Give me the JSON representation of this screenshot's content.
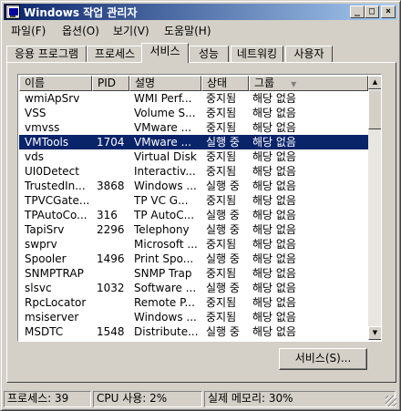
{
  "window": {
    "title": "Windows 작업 관리자",
    "caption_buttons": {
      "minimize": "_",
      "maximize": "□",
      "close": "×"
    }
  },
  "menu": [
    {
      "label": "파일(F)"
    },
    {
      "label": "옵션(O)"
    },
    {
      "label": "보기(V)"
    },
    {
      "label": "도움말(H)"
    }
  ],
  "tabs": [
    {
      "label": "응용 프로그램"
    },
    {
      "label": "프로세스"
    },
    {
      "label": "서비스",
      "active": true
    },
    {
      "label": "성능"
    },
    {
      "label": "네트워킹"
    },
    {
      "label": "사용자"
    }
  ],
  "services": {
    "columns": [
      "이름",
      "PID",
      "설명",
      "상태",
      "그룹"
    ],
    "rows": [
      {
        "name": "wmiApSrv",
        "pid": "",
        "description": "WMI Perf...",
        "status": "중지됨",
        "group": "해당 없음"
      },
      {
        "name": "VSS",
        "pid": "",
        "description": "Volume S...",
        "status": "중지됨",
        "group": "해당 없음"
      },
      {
        "name": "vmvss",
        "pid": "",
        "description": "VMware ...",
        "status": "중지됨",
        "group": "해당 없음"
      },
      {
        "name": "VMTools",
        "pid": "1704",
        "description": "VMware ...",
        "status": "실행 중",
        "group": "해당 없음",
        "selected": true
      },
      {
        "name": "vds",
        "pid": "",
        "description": "Virtual Disk",
        "status": "중지됨",
        "group": "해당 없음"
      },
      {
        "name": "UI0Detect",
        "pid": "",
        "description": "Interactiv...",
        "status": "중지됨",
        "group": "해당 없음"
      },
      {
        "name": "TrustedIn...",
        "pid": "3868",
        "description": "Windows ...",
        "status": "실행 중",
        "group": "해당 없음"
      },
      {
        "name": "TPVCGate...",
        "pid": "",
        "description": "TP VC G...",
        "status": "중지됨",
        "group": "해당 없음"
      },
      {
        "name": "TPAutoCo...",
        "pid": "316",
        "description": "TP AutoC...",
        "status": "실행 중",
        "group": "해당 없음"
      },
      {
        "name": "TapiSrv",
        "pid": "2296",
        "description": "Telephony",
        "status": "실행 중",
        "group": "해당 없음"
      },
      {
        "name": "swprv",
        "pid": "",
        "description": "Microsoft ...",
        "status": "중지됨",
        "group": "해당 없음"
      },
      {
        "name": "Spooler",
        "pid": "1496",
        "description": "Print Spo...",
        "status": "실행 중",
        "group": "해당 없음"
      },
      {
        "name": "SNMPTRAP",
        "pid": "",
        "description": "SNMP Trap",
        "status": "중지됨",
        "group": "해당 없음"
      },
      {
        "name": "slsvc",
        "pid": "1032",
        "description": "Software ...",
        "status": "실행 중",
        "group": "해당 없음"
      },
      {
        "name": "RpcLocator",
        "pid": "",
        "description": "Remote P...",
        "status": "중지됨",
        "group": "해당 없음"
      },
      {
        "name": "msiserver",
        "pid": "",
        "description": "Windows ...",
        "status": "중지됨",
        "group": "해당 없음"
      },
      {
        "name": "MSDTC",
        "pid": "1548",
        "description": "Distribute...",
        "status": "실행 중",
        "group": "해당 없음"
      }
    ],
    "scroll": {
      "up": "▲",
      "down": "▼",
      "sort_indicator": "▼"
    }
  },
  "buttons": {
    "services": "서비스(S)..."
  },
  "statusbar": {
    "processes": "프로세스: 39",
    "cpu": "CPU 사용: 2%",
    "memory": "실제 메모리: 30%"
  },
  "colors": {
    "title_gradient_start": "#0a246a",
    "title_gradient_end": "#a6caf0",
    "selection": "#0a246a",
    "face": "#d4d0c8"
  }
}
